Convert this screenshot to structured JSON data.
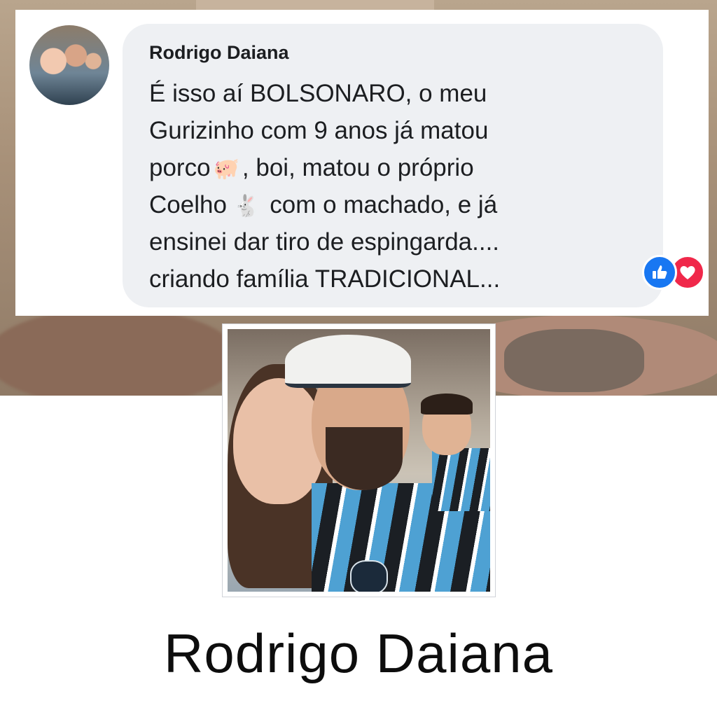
{
  "comment": {
    "author": "Rodrigo Daiana",
    "lines": [
      "É isso aí BOLSONARO, o meu",
      "Gurizinho com 9 anos já matou",
      "porco",
      ", boi, matou o próprio",
      "Coelho",
      "com o machado, e já",
      "ensinei dar tiro de espingarda....",
      "criando família TRADICIONAL..."
    ],
    "emoji_pig": "🐖",
    "emoji_rabbit": "🐇",
    "reactions": [
      "like",
      "love"
    ]
  },
  "profile": {
    "name": "Rodrigo Daiana"
  },
  "colors": {
    "bubble": "#eef0f3",
    "like": "#1877f2",
    "love": "#f0284a",
    "text": "#1c1e21"
  }
}
